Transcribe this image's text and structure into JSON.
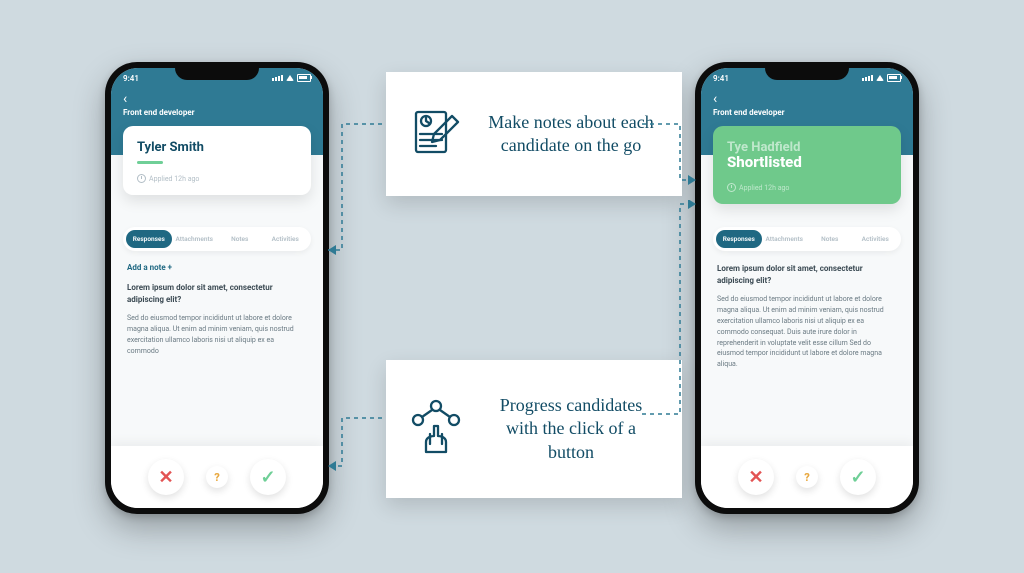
{
  "status_time": "9:41",
  "left_phone": {
    "job_title": "Front end developer",
    "candidate_name": "Tyler Smith",
    "applied_ago": "Applied 12h ago",
    "tabs": {
      "responses": "Responses",
      "attachments": "Attachments",
      "notes": "Notes",
      "activities": "Activities"
    },
    "add_note": "Add a note  +",
    "question": "Lorem ipsum dolor sit amet, consectetur adipiscing elit?",
    "answer": "Sed do eiusmod tempor incididunt ut labore et dolore magna aliqua. Ut enim ad minim veniam, quis nostrud exercitation ullamco laboris nisi ut aliquip ex ea commodo"
  },
  "right_phone": {
    "job_title": "Front end developer",
    "candidate_name": "Tye Hadfield",
    "shortlisted_label": "Shortlisted",
    "applied_ago": "Applied 12h ago",
    "tabs": {
      "responses": "Responses",
      "attachments": "Attachments",
      "notes": "Notes",
      "activities": "Activities"
    },
    "question": "Lorem ipsum dolor sit amet, consectetur adipiscing elit?",
    "answer1": "Sed do eiusmod tempor incididunt ut labore et dolore magna aliqua. Ut enim ad minim veniam, quis nostrud exercitation ullamco laboris nisi ut aliquip ex ea commodo consequat. Duis aute irure dolor in reprehenderit in voluptate velit esse cillum Sed do eiusmod tempor incididunt ut labore et dolore magna aliqua."
  },
  "callouts": {
    "top": "Make notes about each candidate on the go",
    "bottom": "Progress candidates with the click of a button"
  },
  "icons": {
    "back": "chevron-left-icon",
    "signal": "signal-icon",
    "wifi": "wifi-icon",
    "battery": "battery-icon",
    "clock": "clock-icon",
    "reject": "x-icon",
    "maybe": "question-icon",
    "accept": "check-icon",
    "notes": "notes-pencil-icon",
    "progress": "network-tap-icon"
  }
}
